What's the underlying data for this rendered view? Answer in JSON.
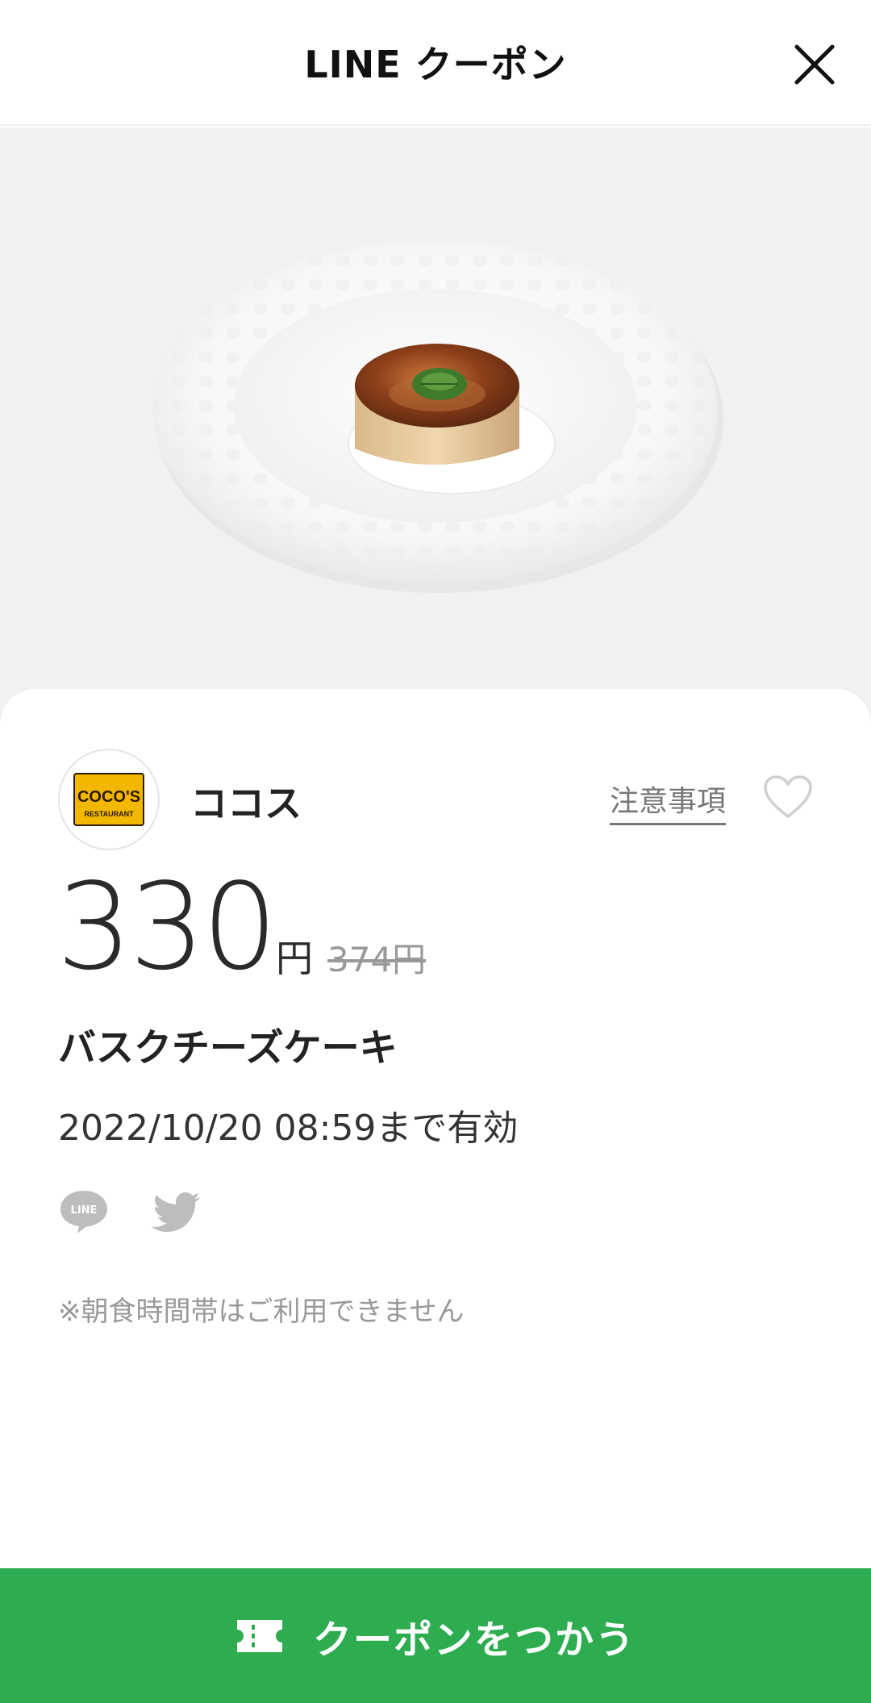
{
  "header": {
    "title": "LINE クーポン"
  },
  "shop": {
    "logo_text": "COCO'S",
    "logo_subtext": "RESTAURANT",
    "name": "ココス",
    "notice_label": "注意事項"
  },
  "coupon": {
    "price": "330",
    "price_unit": "円",
    "original_price": "374円",
    "product_name": "バスクチーズケーキ",
    "valid_until": "2022/10/20  08:59まで有効",
    "note": "※朝食時間帯はご利用できません"
  },
  "cta": {
    "label": "クーポンをつかう"
  },
  "colors": {
    "brand_green": "#2ead50",
    "hero_bg": "#f1f1f1",
    "logo_yellow": "#f2b800"
  },
  "icons": {
    "close": "close-icon",
    "favorite": "heart-outline-icon",
    "share_line": "line-logo-icon",
    "share_twitter": "twitter-bird-icon",
    "ticket": "ticket-icon"
  }
}
